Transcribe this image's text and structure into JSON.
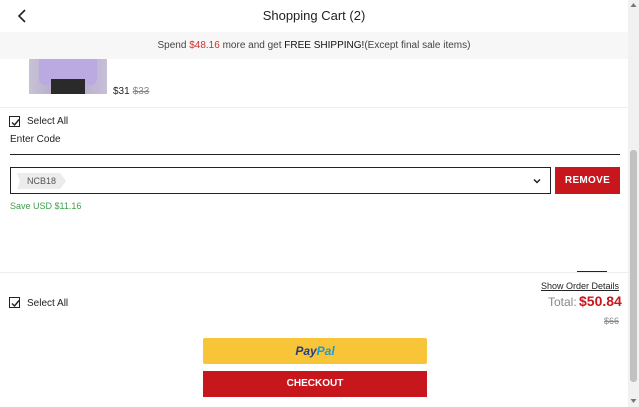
{
  "header": {
    "title": "Shopping Cart (2)",
    "back_icon": "chevron-left-icon"
  },
  "shipping_bar": {
    "prefix": "Spend ",
    "amount": "$48.16",
    "middle": " more and get ",
    "free": "FREE SHIPPING!",
    "suffix": "(Except final sale items)"
  },
  "product": {
    "price": "$31",
    "original_price": "$33"
  },
  "select_all_top": {
    "label": "Select All",
    "checked": true
  },
  "coupon": {
    "label": "Enter Code",
    "selected_code": "NCB18",
    "remove_label": "REMOVE",
    "save_text": "Save USD $11.16"
  },
  "footer": {
    "select_all_label": "Select All",
    "show_order_details": "Show Order Details",
    "total_label": "Total:",
    "total_value": "$50.84",
    "original_total": "$66",
    "paypal_pay": "Pay",
    "paypal_pal": "Pal",
    "checkout_label": "CHECKOUT"
  },
  "colors": {
    "accent_red": "#c8161d",
    "save_green": "#3aa14b",
    "paypal_yellow": "#f8c539"
  }
}
